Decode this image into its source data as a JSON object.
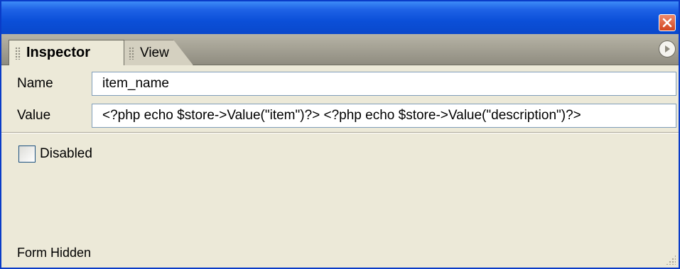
{
  "window": {
    "close_icon": "close-icon"
  },
  "tabs": [
    {
      "label": "Inspector",
      "active": true
    },
    {
      "label": "View",
      "active": false
    }
  ],
  "panel_menu_icon": "play-circle-icon",
  "fields": {
    "name": {
      "label": "Name",
      "value": "item_name"
    },
    "value": {
      "label": "Value",
      "value": "<?php echo $store->Value(\"item\")?> <?php echo $store->Value(\"description\")?>"
    }
  },
  "disabled": {
    "label": "Disabled",
    "checked": false
  },
  "status": {
    "text": "Form Hidden"
  },
  "colors": {
    "titlebar": "#0a48cb",
    "panel": "#ece9d8",
    "close": "#d1451f"
  }
}
